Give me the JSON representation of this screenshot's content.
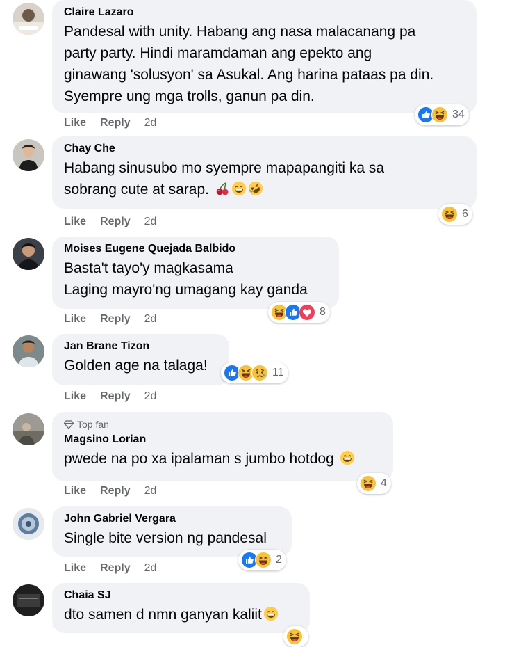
{
  "actions": {
    "like": "Like",
    "reply": "Reply"
  },
  "colors": {
    "like_blue": "#1877f2",
    "haha_yellow": "#f7c23a",
    "love_red": "#f33e58",
    "meta_gray": "#65676b",
    "bubble_bg": "#f0f2f5"
  },
  "comments": [
    {
      "author": "Claire Lazaro",
      "lines": [
        "Pandesal with unity. Habang ang nasa malacanang pa",
        "party party. Hindi maramdaman ang epekto ang",
        "ginawang 'solusyon' sa Asukal. Ang harina pataas pa din.",
        "Syempre ung mga trolls, ganun pa din."
      ],
      "time": "2d",
      "reaction_icons": [
        "like-icon",
        "haha-icon"
      ],
      "reaction_count": "34"
    },
    {
      "author": "Chay Che",
      "lines": [
        "Habang sinusubo mo syempre mapapangiti ka sa",
        "sobrang cute at sarap."
      ],
      "inline_emojis": [
        "cherries-emoji",
        "grinning-emoji",
        "rofl-emoji"
      ],
      "time": "2d",
      "reaction_icons": [
        "haha-icon"
      ],
      "reaction_count": "6"
    },
    {
      "author": "Moises Eugene Quejada Balbido",
      "lines": [
        "Basta't tayo'y magkasama",
        "Laging mayro'ng umagang kay ganda"
      ],
      "time": "2d",
      "reaction_icons": [
        "haha-icon",
        "like-icon",
        "love-icon"
      ],
      "reaction_count": "8"
    },
    {
      "author": "Jan Brane Tizon",
      "lines": [
        "Golden age na talaga!"
      ],
      "time": "2d",
      "reaction_icons": [
        "like-icon",
        "haha-icon",
        "sad-icon"
      ],
      "reaction_count": "11"
    },
    {
      "badge": "Top fan",
      "author": "Magsino Lorian",
      "lines": [
        "pwede na po xa ipalaman s jumbo hotdog"
      ],
      "inline_emojis": [
        "grinning-emoji"
      ],
      "time": "2d",
      "reaction_icons": [
        "haha-icon"
      ],
      "reaction_count": "4"
    },
    {
      "author": "John Gabriel Vergara",
      "lines": [
        "Single bite version ng pandesal"
      ],
      "time": "2d",
      "reaction_icons": [
        "like-icon",
        "haha-icon"
      ],
      "reaction_count": "2"
    },
    {
      "author": "Chaia SJ",
      "lines": [
        "dto samen d nmn ganyan kaliit"
      ],
      "inline_emojis": [
        "grinning-emoji"
      ],
      "reaction_icons": [
        "haha-icon"
      ]
    }
  ]
}
